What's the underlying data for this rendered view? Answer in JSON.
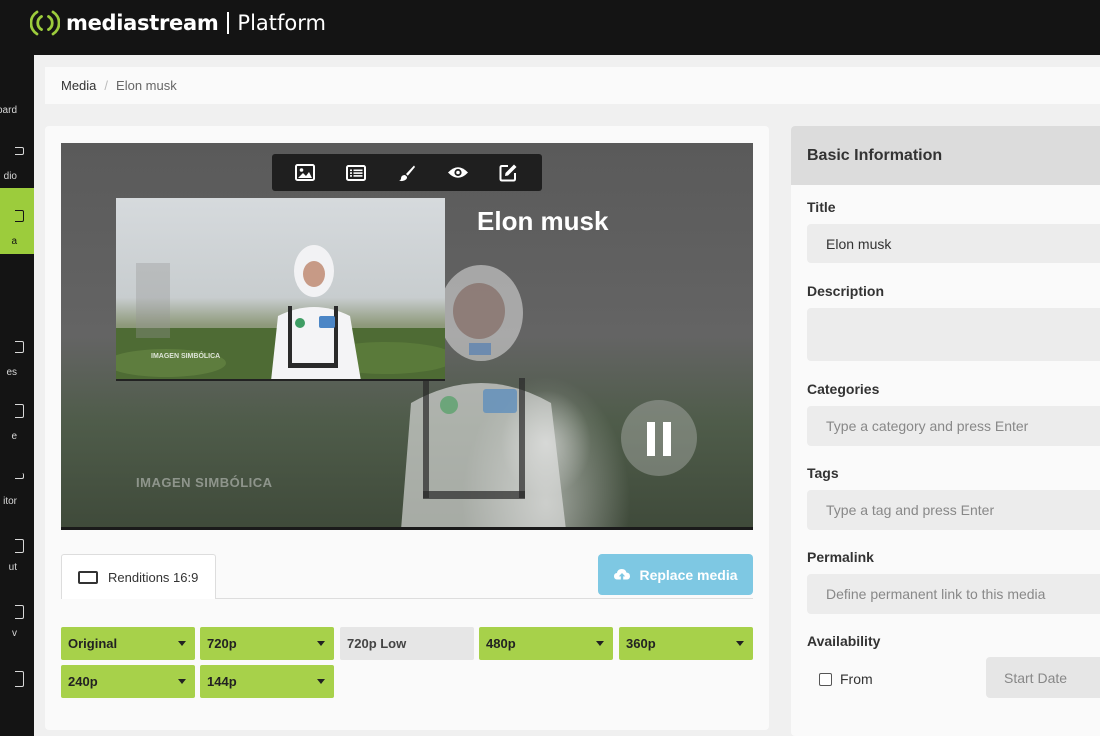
{
  "topbar": {
    "brand": "mediastream",
    "product": "Platform"
  },
  "leftnav": {
    "items": [
      {
        "label": "oard",
        "icon": "dashboard-icon"
      },
      {
        "label": "dio",
        "icon": "audio-icon"
      },
      {
        "label": "a",
        "icon": "media-icon",
        "active": true
      },
      {
        "label": "",
        "icon": "nav-icon"
      },
      {
        "label": "es",
        "icon": "playlists-icon"
      },
      {
        "label": "e",
        "icon": "live-icon"
      },
      {
        "label": "itor",
        "icon": "editor-icon"
      },
      {
        "label": "ut",
        "icon": "layout-icon"
      },
      {
        "label": "v",
        "icon": "tv-icon"
      },
      {
        "label": "",
        "icon": "nav-icon"
      }
    ]
  },
  "breadcrumb": {
    "root": "Media",
    "separator": "/",
    "current": "Elon musk"
  },
  "video": {
    "title": "Elon musk",
    "watermark": "IMAGEN SIMBÓLICA",
    "thumb_watermark": "IMAGEN SIMBÓLICA",
    "toolbar": [
      "image-icon",
      "list-icon",
      "brush-icon",
      "eye-icon",
      "edit-icon"
    ]
  },
  "tabs": {
    "renditions": "Renditions 16:9"
  },
  "replace_button": "Replace media",
  "renditions": [
    {
      "label": "Original",
      "enabled": true
    },
    {
      "label": "720p",
      "enabled": true
    },
    {
      "label": "720p Low",
      "enabled": false
    },
    {
      "label": "480p",
      "enabled": true
    },
    {
      "label": "360p",
      "enabled": true
    },
    {
      "label": "240p",
      "enabled": true
    },
    {
      "label": "144p",
      "enabled": true
    }
  ],
  "side": {
    "header": "Basic Information",
    "title_label": "Title",
    "title_value": "Elon musk",
    "description_label": "Description",
    "description_value": "",
    "categories_label": "Categories",
    "categories_placeholder": "Type a category and press Enter",
    "tags_label": "Tags",
    "tags_placeholder": "Type a tag and press Enter",
    "permalink_label": "Permalink",
    "permalink_placeholder": "Define permanent link to this media",
    "availability_label": "Availability",
    "from_label": "From",
    "start_date_placeholder": "Start Date"
  },
  "colors": {
    "accent": "#a7d14a",
    "replace_button": "#7ec8e3",
    "topbar": "#141414"
  }
}
